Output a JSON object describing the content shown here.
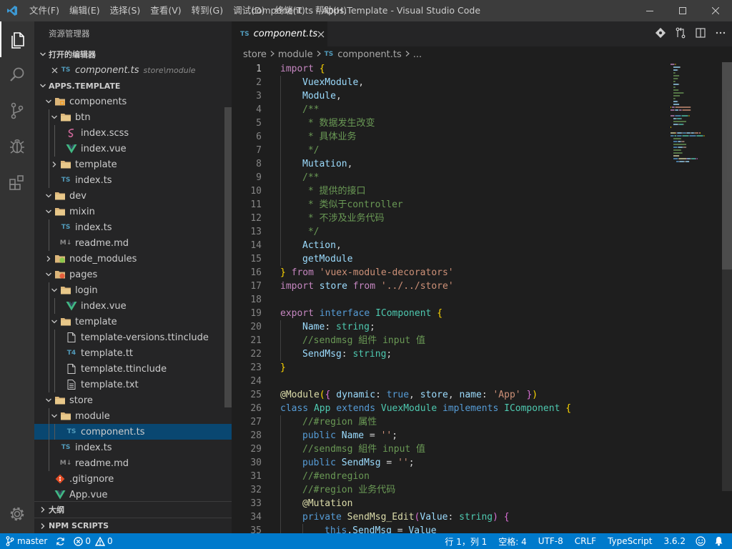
{
  "window": {
    "title": "component.ts - Apps.Template - Visual Studio Code",
    "menus": [
      "文件(F)",
      "编辑(E)",
      "选择(S)",
      "查看(V)",
      "转到(G)",
      "调试(D)",
      "终端(T)",
      "帮助(H)"
    ]
  },
  "colors": {
    "accent": "#007acc",
    "titlebar": "#3c3c3c",
    "sidebar": "#252526",
    "editor": "#1e1e1e",
    "selection": "#094771"
  },
  "sidebar": {
    "title": "资源管理器",
    "open_editors": {
      "header": "打开的编辑器",
      "items": [
        {
          "badge": "TS",
          "name": "component.ts",
          "path": "store\\module"
        }
      ]
    },
    "workspace": {
      "header": "APPS.TEMPLATE",
      "tree": [
        {
          "name": "components",
          "depth": 1,
          "twisty": "open",
          "icon": "folder-components-icon"
        },
        {
          "name": "btn",
          "depth": 2,
          "twisty": "open",
          "icon": "folder-icon"
        },
        {
          "name": "index.scss",
          "depth": 3,
          "twisty": "none",
          "icon": "sass-icon"
        },
        {
          "name": "index.vue",
          "depth": 3,
          "twisty": "none",
          "icon": "vue-icon"
        },
        {
          "name": "template",
          "depth": 2,
          "twisty": "closed",
          "icon": "folder-icon"
        },
        {
          "name": "index.ts",
          "depth": 2,
          "twisty": "none",
          "icon": "ts-icon",
          "badge": "TS"
        },
        {
          "name": "dev",
          "depth": 1,
          "twisty": "open",
          "icon": "folder-icon"
        },
        {
          "name": "mixin",
          "depth": 1,
          "twisty": "open",
          "icon": "folder-icon"
        },
        {
          "name": "index.ts",
          "depth": 2,
          "twisty": "none",
          "icon": "ts-icon",
          "badge": "TS"
        },
        {
          "name": "readme.md",
          "depth": 2,
          "twisty": "none",
          "icon": "markdown-icon",
          "badge": "M↓"
        },
        {
          "name": "node_modules",
          "depth": 1,
          "twisty": "closed",
          "icon": "folder-node-icon"
        },
        {
          "name": "pages",
          "depth": 1,
          "twisty": "open",
          "icon": "folder-pages-icon"
        },
        {
          "name": "login",
          "depth": 2,
          "twisty": "open",
          "icon": "folder-icon"
        },
        {
          "name": "index.vue",
          "depth": 3,
          "twisty": "none",
          "icon": "vue-icon"
        },
        {
          "name": "template",
          "depth": 2,
          "twisty": "open",
          "icon": "folder-icon"
        },
        {
          "name": "template-versions.ttinclude",
          "depth": 3,
          "twisty": "none",
          "icon": "file-icon"
        },
        {
          "name": "template.tt",
          "depth": 3,
          "twisty": "none",
          "icon": "t4-icon",
          "badge": "T4"
        },
        {
          "name": "template.ttinclude",
          "depth": 3,
          "twisty": "none",
          "icon": "file-icon"
        },
        {
          "name": "template.txt",
          "depth": 3,
          "twisty": "none",
          "icon": "text-file-icon"
        },
        {
          "name": "store",
          "depth": 1,
          "twisty": "open",
          "icon": "folder-icon"
        },
        {
          "name": "module",
          "depth": 2,
          "twisty": "open",
          "icon": "folder-icon"
        },
        {
          "name": "component.ts",
          "depth": 3,
          "twisty": "none",
          "icon": "ts-icon",
          "badge": "TS",
          "selected": true
        },
        {
          "name": "index.ts",
          "depth": 2,
          "twisty": "none",
          "icon": "ts-icon",
          "badge": "TS"
        },
        {
          "name": "readme.md",
          "depth": 2,
          "twisty": "none",
          "icon": "markdown-icon",
          "badge": "M↓"
        },
        {
          "name": ".gitignore",
          "depth": 1,
          "twisty": "none",
          "icon": "git-icon"
        },
        {
          "name": "App.vue",
          "depth": 1,
          "twisty": "none",
          "icon": "vue-icon"
        }
      ]
    },
    "outline_header": "大纲",
    "npm_header": "NPM SCRIPTS"
  },
  "editor": {
    "tab": {
      "badge": "TS",
      "name": "component.ts"
    },
    "breadcrumb": [
      "store",
      "module",
      "component.ts",
      "..."
    ],
    "breadcrumb_badge": "TS",
    "current_line": 1,
    "lines": [
      {
        "n": 1,
        "i": 0,
        "t": [
          [
            "kc",
            "import"
          ],
          [
            "pu",
            " "
          ],
          [
            "br1",
            "{"
          ]
        ]
      },
      {
        "n": 2,
        "i": 1,
        "t": [
          [
            "va",
            "VuexModule"
          ],
          [
            "pu",
            ","
          ]
        ]
      },
      {
        "n": 3,
        "i": 1,
        "t": [
          [
            "va",
            "Module"
          ],
          [
            "pu",
            ","
          ]
        ]
      },
      {
        "n": 4,
        "i": 1,
        "t": [
          [
            "cm",
            "/**"
          ]
        ]
      },
      {
        "n": 5,
        "i": 1,
        "t": [
          [
            "cm",
            " * 数据发生改变"
          ]
        ]
      },
      {
        "n": 6,
        "i": 1,
        "t": [
          [
            "cm",
            " * 具体业务"
          ]
        ]
      },
      {
        "n": 7,
        "i": 1,
        "t": [
          [
            "cm",
            " */"
          ]
        ]
      },
      {
        "n": 8,
        "i": 1,
        "t": [
          [
            "va",
            "Mutation"
          ],
          [
            "pu",
            ","
          ]
        ]
      },
      {
        "n": 9,
        "i": 1,
        "t": [
          [
            "cm",
            "/**"
          ]
        ]
      },
      {
        "n": 10,
        "i": 1,
        "t": [
          [
            "cm",
            " * 提供的接口"
          ]
        ]
      },
      {
        "n": 11,
        "i": 1,
        "t": [
          [
            "cm",
            " * 类似于controller"
          ]
        ]
      },
      {
        "n": 12,
        "i": 1,
        "t": [
          [
            "cm",
            " * 不涉及业务代码"
          ]
        ]
      },
      {
        "n": 13,
        "i": 1,
        "t": [
          [
            "cm",
            " */"
          ]
        ]
      },
      {
        "n": 14,
        "i": 1,
        "t": [
          [
            "va",
            "Action"
          ],
          [
            "pu",
            ","
          ]
        ]
      },
      {
        "n": 15,
        "i": 1,
        "t": [
          [
            "va",
            "getModule"
          ]
        ]
      },
      {
        "n": 16,
        "i": 0,
        "t": [
          [
            "br1",
            "}"
          ],
          [
            "pu",
            " "
          ],
          [
            "kc",
            "from"
          ],
          [
            "pu",
            " "
          ],
          [
            "st",
            "'vuex-module-decorators'"
          ]
        ]
      },
      {
        "n": 17,
        "i": 0,
        "t": [
          [
            "kc",
            "import"
          ],
          [
            "pu",
            " "
          ],
          [
            "va",
            "store"
          ],
          [
            "pu",
            " "
          ],
          [
            "kc",
            "from"
          ],
          [
            "pu",
            " "
          ],
          [
            "st",
            "'../../store'"
          ]
        ]
      },
      {
        "n": 18,
        "i": 0,
        "t": []
      },
      {
        "n": 19,
        "i": 0,
        "t": [
          [
            "kc",
            "export"
          ],
          [
            "pu",
            " "
          ],
          [
            "kw",
            "interface"
          ],
          [
            "pu",
            " "
          ],
          [
            "ty",
            "IComponent"
          ],
          [
            "pu",
            " "
          ],
          [
            "br1",
            "{"
          ]
        ]
      },
      {
        "n": 20,
        "i": 1,
        "t": [
          [
            "va",
            "Name"
          ],
          [
            "pu",
            ": "
          ],
          [
            "ty",
            "string"
          ],
          [
            "pu",
            ";"
          ]
        ]
      },
      {
        "n": 21,
        "i": 1,
        "t": [
          [
            "cm",
            "//sendmsg 組件 input 值"
          ]
        ]
      },
      {
        "n": 22,
        "i": 1,
        "t": [
          [
            "va",
            "SendMsg"
          ],
          [
            "pu",
            ": "
          ],
          [
            "ty",
            "string"
          ],
          [
            "pu",
            ";"
          ]
        ]
      },
      {
        "n": 23,
        "i": 0,
        "t": [
          [
            "br1",
            "}"
          ]
        ]
      },
      {
        "n": 24,
        "i": 0,
        "t": []
      },
      {
        "n": 25,
        "i": 0,
        "t": [
          [
            "fn",
            "@Module"
          ],
          [
            "br1",
            "("
          ],
          [
            "br2",
            "{"
          ],
          [
            "pu",
            " "
          ],
          [
            "va",
            "dynamic"
          ],
          [
            "pu",
            ": "
          ],
          [
            "kw",
            "true"
          ],
          [
            "pu",
            ", "
          ],
          [
            "va",
            "store"
          ],
          [
            "pu",
            ", "
          ],
          [
            "va",
            "name"
          ],
          [
            "pu",
            ": "
          ],
          [
            "st",
            "'App'"
          ],
          [
            "pu",
            " "
          ],
          [
            "br2",
            "}"
          ],
          [
            "br1",
            ")"
          ]
        ]
      },
      {
        "n": 26,
        "i": 0,
        "t": [
          [
            "kw",
            "class"
          ],
          [
            "pu",
            " "
          ],
          [
            "ty",
            "App"
          ],
          [
            "pu",
            " "
          ],
          [
            "kw",
            "extends"
          ],
          [
            "pu",
            " "
          ],
          [
            "ty",
            "VuexModule"
          ],
          [
            "pu",
            " "
          ],
          [
            "kw",
            "implements"
          ],
          [
            "pu",
            " "
          ],
          [
            "ty",
            "IComponent"
          ],
          [
            "pu",
            " "
          ],
          [
            "br1",
            "{"
          ]
        ]
      },
      {
        "n": 27,
        "i": 1,
        "t": [
          [
            "cm",
            "//#region 属性"
          ]
        ]
      },
      {
        "n": 28,
        "i": 1,
        "t": [
          [
            "kw",
            "public"
          ],
          [
            "pu",
            " "
          ],
          [
            "va",
            "Name"
          ],
          [
            "pu",
            " = "
          ],
          [
            "st",
            "''"
          ],
          [
            "pu",
            ";"
          ]
        ]
      },
      {
        "n": 29,
        "i": 1,
        "t": [
          [
            "cm",
            "//sendmsg 組件 input 值"
          ]
        ]
      },
      {
        "n": 30,
        "i": 1,
        "t": [
          [
            "kw",
            "public"
          ],
          [
            "pu",
            " "
          ],
          [
            "va",
            "SendMsg"
          ],
          [
            "pu",
            " = "
          ],
          [
            "st",
            "''"
          ],
          [
            "pu",
            ";"
          ]
        ]
      },
      {
        "n": 31,
        "i": 1,
        "t": [
          [
            "cm",
            "//#endregion"
          ]
        ]
      },
      {
        "n": 32,
        "i": 1,
        "t": [
          [
            "cm",
            "//#region 业务代码"
          ]
        ]
      },
      {
        "n": 33,
        "i": 1,
        "t": [
          [
            "fn",
            "@Mutation"
          ]
        ]
      },
      {
        "n": 34,
        "i": 1,
        "t": [
          [
            "kw",
            "private"
          ],
          [
            "pu",
            " "
          ],
          [
            "fn",
            "SendMsg_Edit"
          ],
          [
            "br2",
            "("
          ],
          [
            "va",
            "Value"
          ],
          [
            "pu",
            ": "
          ],
          [
            "ty",
            "string"
          ],
          [
            "br2",
            ")"
          ],
          [
            "pu",
            " "
          ],
          [
            "br2",
            "{"
          ]
        ]
      },
      {
        "n": 35,
        "i": 2,
        "t": [
          [
            "kw",
            "this"
          ],
          [
            "pu",
            "."
          ],
          [
            "va",
            "SendMsg"
          ],
          [
            "pu",
            " = "
          ],
          [
            "va",
            "Value"
          ]
        ]
      }
    ]
  },
  "statusbar": {
    "branch": "master",
    "errors": "0",
    "warnings": "0",
    "position": "行 1，列 1",
    "indent": "空格: 4",
    "encoding": "UTF-8",
    "eol": "CRLF",
    "language": "TypeScript",
    "version": "3.6.2"
  }
}
